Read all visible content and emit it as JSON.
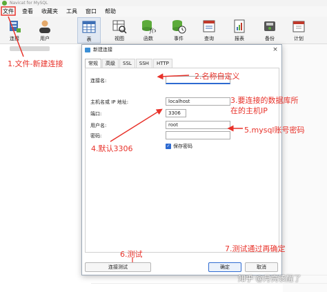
{
  "window": {
    "title": "Navicat for MySQL"
  },
  "menu": [
    "文件",
    "查看",
    "收藏夹",
    "工具",
    "窗口",
    "帮助"
  ],
  "toolbar": [
    {
      "label": "连接",
      "icon": "connection-icon"
    },
    {
      "label": "用户",
      "icon": "user-icon"
    },
    {
      "label": "表",
      "icon": "table-icon"
    },
    {
      "label": "视图",
      "icon": "view-icon"
    },
    {
      "label": "函数",
      "icon": "function-icon"
    },
    {
      "label": "事件",
      "icon": "event-icon"
    },
    {
      "label": "查询",
      "icon": "query-icon"
    },
    {
      "label": "报表",
      "icon": "report-icon"
    },
    {
      "label": "备份",
      "icon": "backup-icon"
    },
    {
      "label": "计划",
      "icon": "schedule-icon"
    }
  ],
  "dialog": {
    "title": "新建连接",
    "close": "×",
    "tabs": [
      "常规",
      "高级",
      "SSL",
      "SSH",
      "HTTP"
    ],
    "fields": {
      "connection_name": {
        "label": "连接名:",
        "value": ""
      },
      "host": {
        "label": "主机名或 IP 地址:",
        "value": "localhost"
      },
      "port": {
        "label": "端口:",
        "value": "3306"
      },
      "username": {
        "label": "用户名:",
        "value": "root"
      },
      "password": {
        "label": "密码:",
        "value": ""
      }
    },
    "save_password": {
      "label": "保存密码",
      "checked": true
    },
    "buttons": {
      "test": "连接测试",
      "ok": "确定",
      "cancel": "取消"
    }
  },
  "annotations": {
    "a1": "1.文件-新建连接",
    "a2": "2.名称自定义",
    "a3_line1": "3.要连接的数据库所",
    "a3_line2": "在的主机IP",
    "a4": "4.默认3306",
    "a5": "5.mysql账号密码",
    "a6": "6.测试",
    "a7": "7.测试通过再确定"
  },
  "watermark": "知乎 @月亮该醒了",
  "colors": {
    "annotation": "#e8322a",
    "accent": "#2d6ad1"
  }
}
